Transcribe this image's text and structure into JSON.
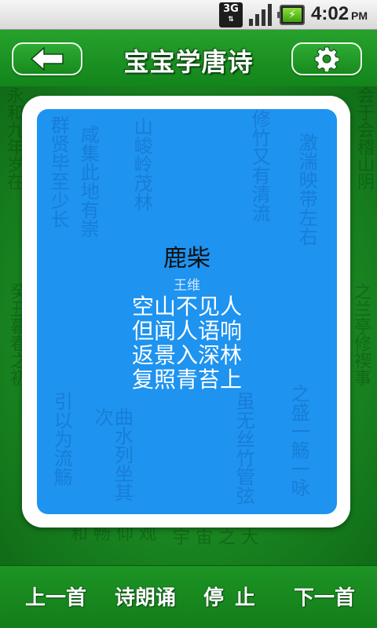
{
  "status_bar": {
    "network": "3G",
    "time": "4:02",
    "ampm": "PM",
    "battery_symbol": "⚡"
  },
  "header": {
    "title": "宝宝学唐诗",
    "back_icon": "arrow-left-icon",
    "settings_icon": "gear-icon"
  },
  "poem": {
    "title": "鹿柴",
    "author": "王维",
    "lines": [
      "空山不见人",
      "但闻人语响",
      "返景入深林",
      "复照青苔上"
    ]
  },
  "controls": {
    "prev": "上一首",
    "recite": "诗朗诵",
    "stop": "停止",
    "next": "下一首"
  },
  "colors": {
    "header_green": "#1f9a25",
    "card_blue": "#1e93f0",
    "card_frame": "#ffffff",
    "status_bar": "#e6e6e6"
  }
}
